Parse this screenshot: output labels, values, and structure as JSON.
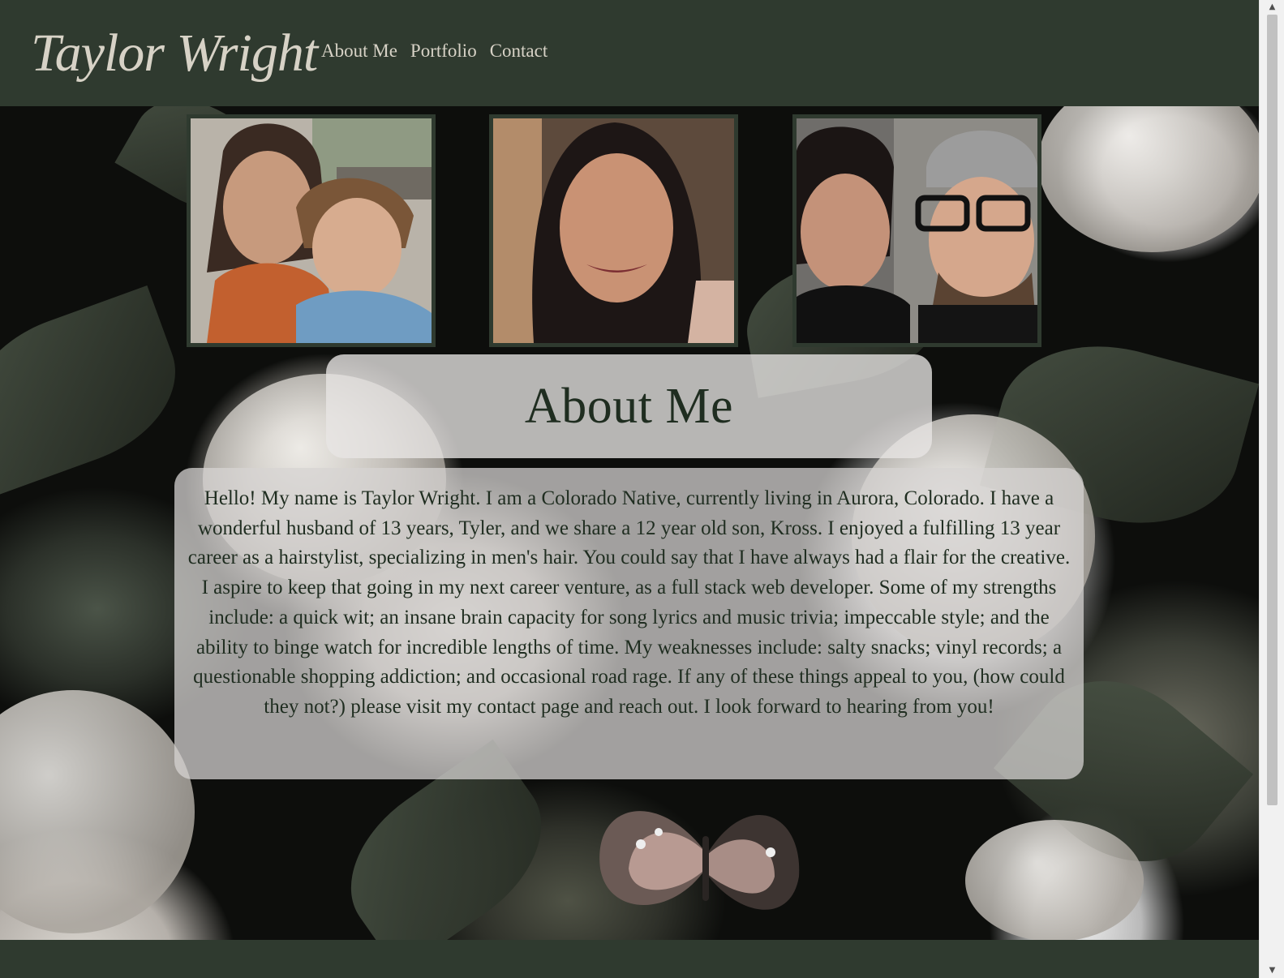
{
  "header": {
    "brand": "Taylor Wright",
    "nav": {
      "about": "About Me",
      "portfolio": "Portfolio",
      "contact": "Contact"
    }
  },
  "main": {
    "heading": "About Me",
    "bio": "Hello! My name is Taylor Wright. I am a Colorado Native, currently living in Aurora, Colorado. I have a wonderful husband of 13 years, Tyler, and we share a 12 year old son, Kross. I enjoyed a fulfilling 13 year career as a hairstylist, specializing in men's hair. You could say that I have always had a flair for the creative. I aspire to keep that going in my next career venture, as a full stack web developer. Some of my strengths include: a quick wit; an insane brain capacity for song lyrics and music trivia; impeccable style; and the ability to binge watch for incredible lengths of time. My weaknesses include: salty snacks; vinyl records; a questionable shopping addiction; and occasional road rage. If any of these things appeal to you, (how could they not?) please visit my contact page and reach out. I look forward to hearing from you!"
  },
  "colors": {
    "header_bg": "#2f3a2f",
    "header_text": "#d7d2c6",
    "heading_text": "#1f2d20"
  }
}
